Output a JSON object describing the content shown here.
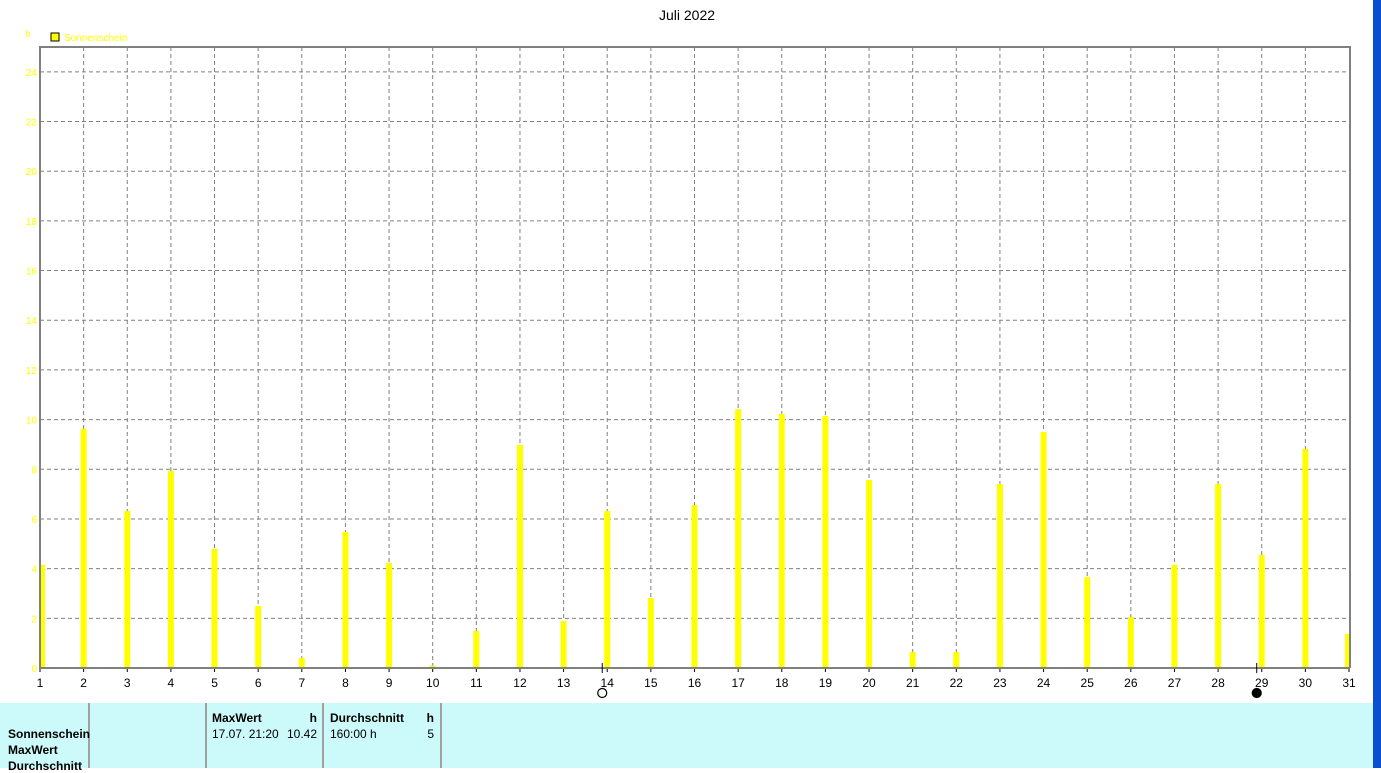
{
  "chart_data": {
    "type": "bar",
    "title": "Juli 2022",
    "ylabel": "h",
    "xlabel": "",
    "legend": {
      "entries": [
        "Sonnenschein"
      ],
      "placement": "top-left"
    },
    "grid": true,
    "ylim": [
      0,
      25
    ],
    "yticks": [
      0,
      2,
      4,
      6,
      8,
      10,
      12,
      14,
      16,
      18,
      20,
      22,
      24
    ],
    "categories": [
      "1",
      "2",
      "3",
      "4",
      "5",
      "6",
      "7",
      "8",
      "9",
      "10",
      "11",
      "12",
      "13",
      "14",
      "15",
      "16",
      "17",
      "18",
      "19",
      "20",
      "21",
      "22",
      "23",
      "24",
      "25",
      "26",
      "27",
      "28",
      "29",
      "30",
      "31"
    ],
    "series": [
      {
        "name": "Sonnenschein",
        "color": "#ffff00",
        "values": [
          4.15,
          9.63,
          6.32,
          7.93,
          4.79,
          2.5,
          0.4,
          5.48,
          4.23,
          0.1,
          1.49,
          8.98,
          1.89,
          6.32,
          2.82,
          6.56,
          10.42,
          10.23,
          10.15,
          7.57,
          0.64,
          0.64,
          7.41,
          9.5,
          3.66,
          2.05,
          4.15,
          7.41,
          4.55,
          8.82,
          1.37
        ]
      }
    ],
    "annotations": [
      {
        "day": 14,
        "symbol": "full-moon"
      },
      {
        "day": 29,
        "symbol": "new-moon"
      }
    ]
  },
  "summary": {
    "row_labels": [
      "Sonnenschein",
      "MaxWert",
      "Durchschnitt"
    ],
    "max_header": "MaxWert",
    "max_unit": "h",
    "max_time": "17.07.  21:20",
    "max_value": "10.42",
    "avg_header": "Durchschnitt",
    "avg_unit": "h",
    "avg_total": "160:00 h",
    "avg_value": "5"
  },
  "colors": {
    "bar": "#ffff00",
    "panel": "#ccf9f9",
    "grid": "#808080",
    "desktop": "#0a4fcf"
  }
}
